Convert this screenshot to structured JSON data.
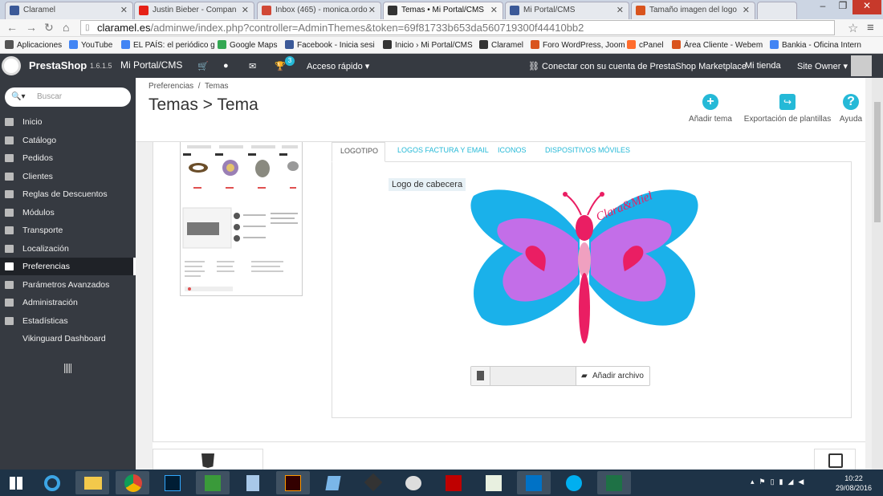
{
  "browser": {
    "tabs": [
      {
        "title": "Claramel",
        "icon": "facebook-icon",
        "color": "#3b5998"
      },
      {
        "title": "Justin Bieber - Compan",
        "icon": "youtube-icon",
        "color": "#e62117"
      },
      {
        "title": "Inbox (465) - monica.ordo",
        "icon": "gmail-icon",
        "color": "#d14836"
      },
      {
        "title": "Temas • Mi Portal/CMS",
        "icon": "prestashop-icon",
        "color": "#333333"
      },
      {
        "title": "Mi Portal/CMS",
        "icon": "facebook-icon",
        "color": "#3b5998"
      },
      {
        "title": "Tamaño imagen del logo",
        "icon": "webempresa-icon",
        "color": "#d9541e"
      }
    ],
    "url_host": "claramel.es",
    "url_rest": "/adminwe/index.php?controller=AdminThemes&token=69f81733b653da560719300f44410bb2",
    "bookmarks": [
      {
        "label": "Aplicaciones",
        "icon": "apps-icon",
        "color": "#555555"
      },
      {
        "label": "YouTube",
        "icon": "google-icon",
        "color": "#4285f4"
      },
      {
        "label": "EL PAÍS: el periódico g",
        "icon": "google-icon",
        "color": "#4285f4"
      },
      {
        "label": "Google Maps",
        "icon": "maps-icon",
        "color": "#34a853"
      },
      {
        "label": "Facebook - Inicia sesi",
        "icon": "facebook-icon",
        "color": "#3b5998"
      },
      {
        "label": "Inicio › Mi Portal/CMS",
        "icon": "prestashop-icon",
        "color": "#333333"
      },
      {
        "label": "Claramel",
        "icon": "prestashop-icon",
        "color": "#333333"
      },
      {
        "label": "Foro WordPress, Joom",
        "icon": "webempresa-icon",
        "color": "#d9541e"
      },
      {
        "label": "cPanel",
        "icon": "cpanel-icon",
        "color": "#ff6c2c"
      },
      {
        "label": "Área Cliente - Webem",
        "icon": "webempresa-icon",
        "color": "#d9541e"
      },
      {
        "label": "Bankia - Oficina Intern",
        "icon": "google-icon",
        "color": "#4285f4"
      }
    ]
  },
  "topbar": {
    "brand": "PrestaShop",
    "version": "1.6.1.5",
    "shop_name": "Mi Portal/CMS",
    "notif_count": "3",
    "quick_access": "Acceso rápido",
    "marketplace": "Conectar con su cuenta de PrestaShop Marketplace",
    "my_shop": "Mi tienda",
    "user": "Site Owner"
  },
  "sidebar": {
    "search_placeholder": "Buscar",
    "items": [
      {
        "label": "Inicio"
      },
      {
        "label": "Catálogo"
      },
      {
        "label": "Pedidos"
      },
      {
        "label": "Clientes"
      },
      {
        "label": "Reglas de Descuentos"
      },
      {
        "label": "Módulos"
      },
      {
        "label": "Transporte"
      },
      {
        "label": "Localización"
      },
      {
        "label": "Preferencias"
      },
      {
        "label": "Parámetros Avanzados"
      },
      {
        "label": "Administración"
      },
      {
        "label": "Estadísticas"
      },
      {
        "label": "Vikinguard Dashboard"
      }
    ]
  },
  "header": {
    "breadcrumb_1": "Preferencias",
    "breadcrumb_sep": "/",
    "breadcrumb_2": "Temas",
    "title": "Temas > Tema",
    "add_theme": "Añadir tema",
    "export": "Exportación de plantillas",
    "help": "Ayuda"
  },
  "tabs": [
    "LOGOTIPO",
    "LOGOS FACTURA Y EMAIL",
    "ICONOS",
    "DISPOSITIVOS MÓVILES"
  ],
  "logo_section": {
    "label": "Logo de cabecera",
    "logo_text": "Clara&Miel",
    "add_file": "Añadir archivo"
  },
  "taskbar": {
    "time": "10:22",
    "date": "29/08/2016"
  },
  "colors": {
    "accent": "#25b9d7",
    "sidebar": "#363a41",
    "wing_blue": "#1ab1ea",
    "wing_purple": "#c36ee8",
    "heart": "#ea1e63"
  }
}
